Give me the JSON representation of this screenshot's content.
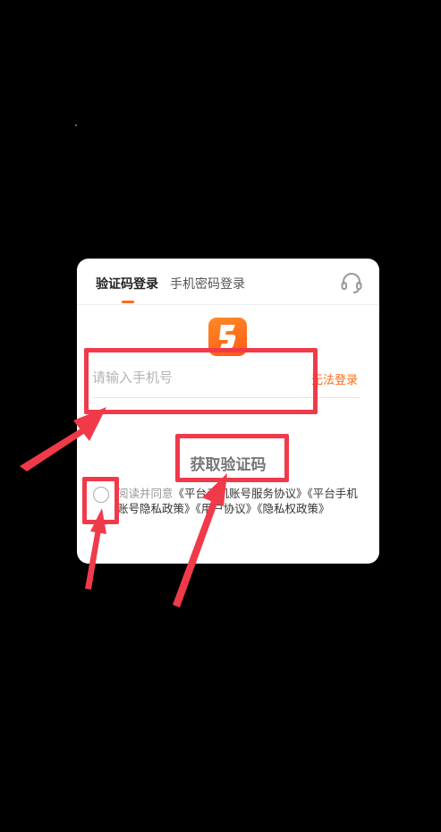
{
  "tabs": {
    "code_login": "验证码登录",
    "password_login": "手机密码登录"
  },
  "icons": {
    "support": "headset-icon",
    "logo": "app-logo-icon"
  },
  "form": {
    "phone_placeholder": "请输入手机号",
    "phone_value": "",
    "cant_login": "无法登录",
    "get_code_button": "获取验证码"
  },
  "agreement": {
    "checked": false,
    "prefix": "阅读并同意",
    "text": "《平台手机账号服务协议》《平台手机账号隐私政策》《用户协议》《隐私权政策》"
  },
  "colors": {
    "accent": "#ff6a1a",
    "highlight": "#f03a4a",
    "background": "#000000"
  }
}
